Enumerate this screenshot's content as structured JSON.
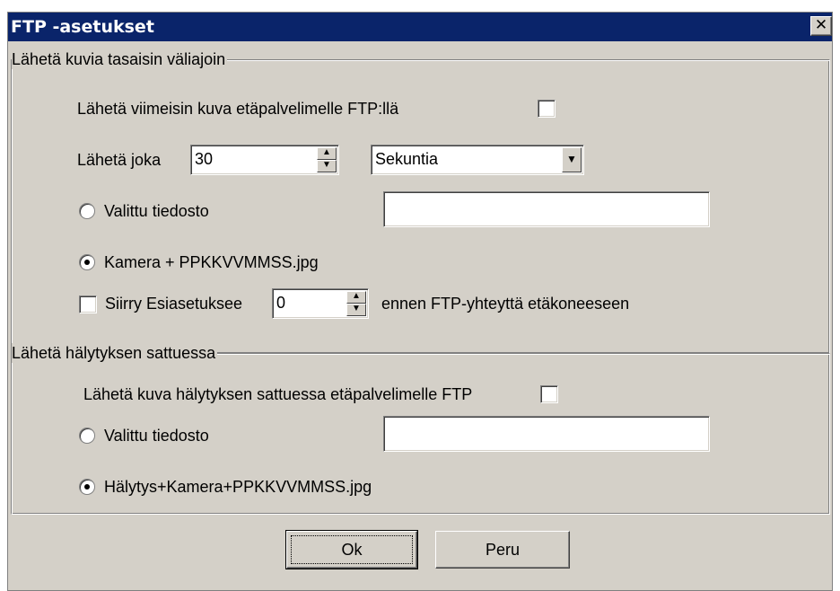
{
  "window": {
    "title": "FTP -asetukset",
    "close_glyph": "✕"
  },
  "interval_group": {
    "title": "Lähetä kuvia tasaisin väliajoin",
    "send_latest_label": "Lähetä viimeisin kuva etäpalvelimelle FTP:llä",
    "send_latest_checked": false,
    "send_every_label": "Lähetä joka",
    "interval_value": "30",
    "unit_value": "Sekuntia",
    "selected_file_label": "Valittu tiedosto",
    "selected_file_value": "",
    "camera_option_label": "Kamera + PPKKVVMMSS.jpg",
    "camera_option_selected": true,
    "preset_checkbox_label": "Siirry Esiasetuksee",
    "preset_value": "0",
    "preset_suffix_label": "ennen FTP-yhteyttä etäkoneeseen"
  },
  "alarm_group": {
    "title": "Lähetä hälytyksen sattuessa",
    "send_on_alarm_label": "Lähetä kuva hälytyksen sattuessa etäpalvelimelle FTP",
    "send_on_alarm_checked": false,
    "selected_file_label": "Valittu tiedosto",
    "selected_file_value": "",
    "alarm_option_label": "Hälytys+Kamera+PPKKVVMMSS.jpg",
    "alarm_option_selected": true
  },
  "buttons": {
    "ok_label": "Ok",
    "cancel_label": "Peru"
  },
  "icons": {
    "spin_up": "▲",
    "spin_down": "▼",
    "combo_arrow": "▼"
  }
}
